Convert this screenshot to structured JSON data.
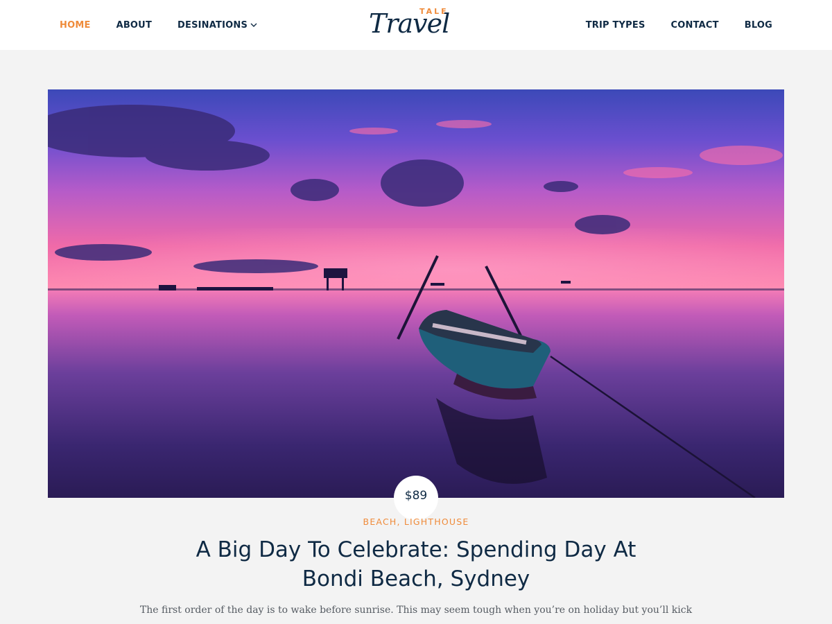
{
  "header": {
    "logo": {
      "top": "TALE",
      "main": "Travel"
    },
    "nav_left": [
      {
        "label": "HOME",
        "active": true
      },
      {
        "label": "ABOUT"
      },
      {
        "label": "DESINATIONS",
        "dropdown": true
      }
    ],
    "nav_right": [
      {
        "label": "TRIP TYPES"
      },
      {
        "label": "CONTACT"
      },
      {
        "label": "BLOG"
      }
    ]
  },
  "post": {
    "price": "$89",
    "categories": [
      "BEACH",
      "LIGHTHOUSE"
    ],
    "category_separator": ", ",
    "title_line1": "A Big Day To Celebrate: Spending Day At",
    "title_line2": "Bondi Beach, Sydney",
    "excerpt": "The first order of the day is to wake before sunrise. This may seem tough when you’re on holiday but you’ll kick"
  },
  "colors": {
    "accent": "#ef8b3a",
    "text_dark": "#0f2a44",
    "background": "#f3f3f3"
  },
  "icons": [
    "chevron-down-icon"
  ]
}
